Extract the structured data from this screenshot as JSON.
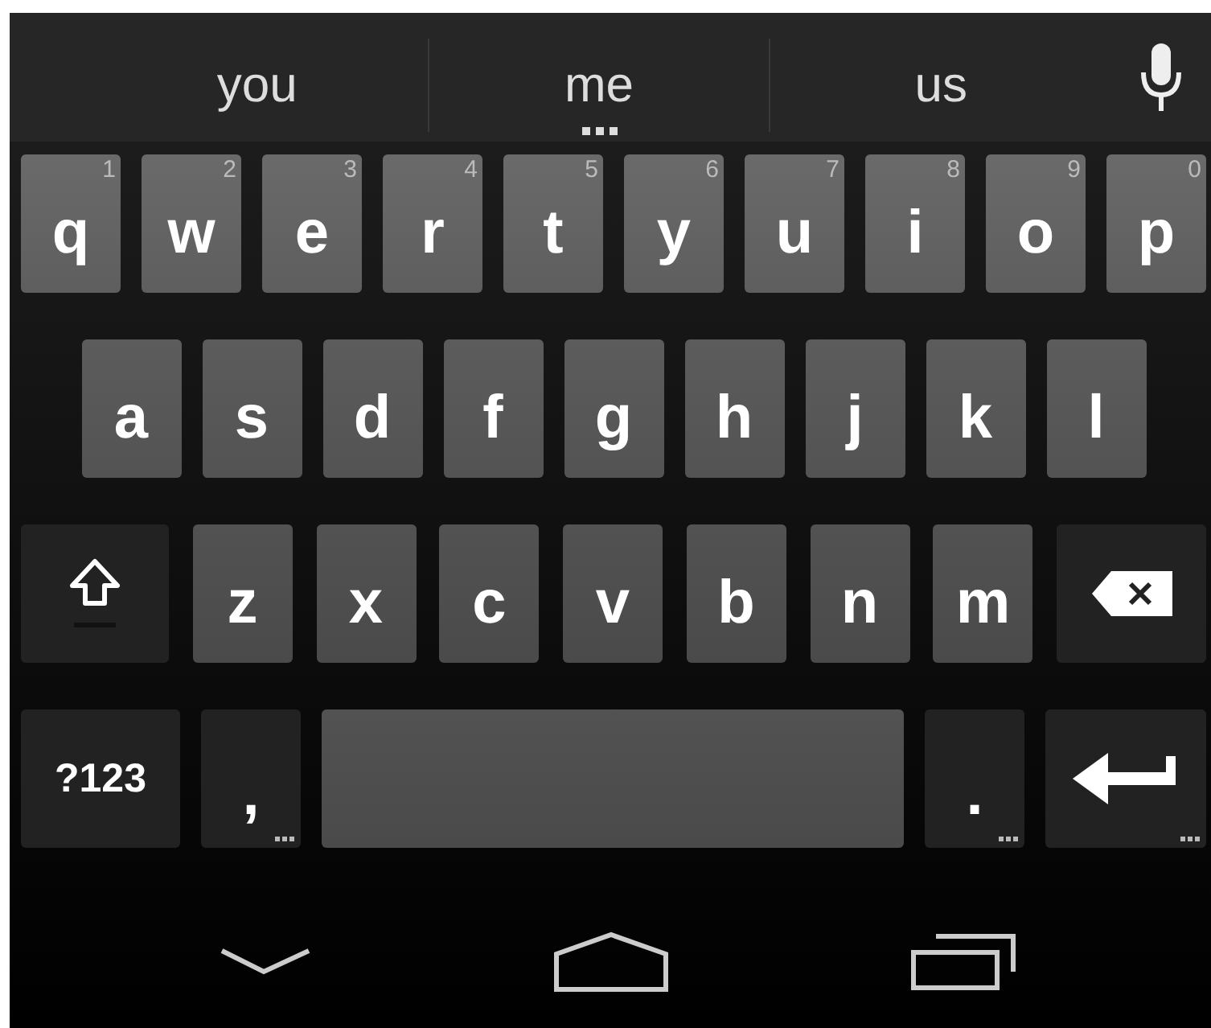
{
  "suggestions": [
    {
      "text": "you",
      "more": false
    },
    {
      "text": "me",
      "more": true
    },
    {
      "text": "us",
      "more": false
    }
  ],
  "voice_button": true,
  "rows": [
    [
      {
        "kind": "letter",
        "label": "q",
        "hint": "1"
      },
      {
        "kind": "letter",
        "label": "w",
        "hint": "2"
      },
      {
        "kind": "letter",
        "label": "e",
        "hint": "3"
      },
      {
        "kind": "letter",
        "label": "r",
        "hint": "4"
      },
      {
        "kind": "letter",
        "label": "t",
        "hint": "5"
      },
      {
        "kind": "letter",
        "label": "y",
        "hint": "6"
      },
      {
        "kind": "letter",
        "label": "u",
        "hint": "7"
      },
      {
        "kind": "letter",
        "label": "i",
        "hint": "8"
      },
      {
        "kind": "letter",
        "label": "o",
        "hint": "9"
      },
      {
        "kind": "letter",
        "label": "p",
        "hint": "0"
      }
    ],
    [
      {
        "kind": "letter",
        "label": "a"
      },
      {
        "kind": "letter",
        "label": "s"
      },
      {
        "kind": "letter",
        "label": "d"
      },
      {
        "kind": "letter",
        "label": "f"
      },
      {
        "kind": "letter",
        "label": "g"
      },
      {
        "kind": "letter",
        "label": "h"
      },
      {
        "kind": "letter",
        "label": "j"
      },
      {
        "kind": "letter",
        "label": "k"
      },
      {
        "kind": "letter",
        "label": "l"
      }
    ],
    [
      {
        "kind": "shift"
      },
      {
        "kind": "letter",
        "label": "z"
      },
      {
        "kind": "letter",
        "label": "x"
      },
      {
        "kind": "letter",
        "label": "c"
      },
      {
        "kind": "letter",
        "label": "v"
      },
      {
        "kind": "letter",
        "label": "b"
      },
      {
        "kind": "letter",
        "label": "n"
      },
      {
        "kind": "letter",
        "label": "m"
      },
      {
        "kind": "delete"
      }
    ],
    [
      {
        "kind": "symbols",
        "label": "?123"
      },
      {
        "kind": "punct",
        "label": ",",
        "more": true
      },
      {
        "kind": "space"
      },
      {
        "kind": "punct",
        "label": ".",
        "more": true
      },
      {
        "kind": "enter",
        "more": true
      }
    ]
  ],
  "nav": [
    {
      "kind": "back"
    },
    {
      "kind": "home"
    },
    {
      "kind": "recents"
    }
  ]
}
